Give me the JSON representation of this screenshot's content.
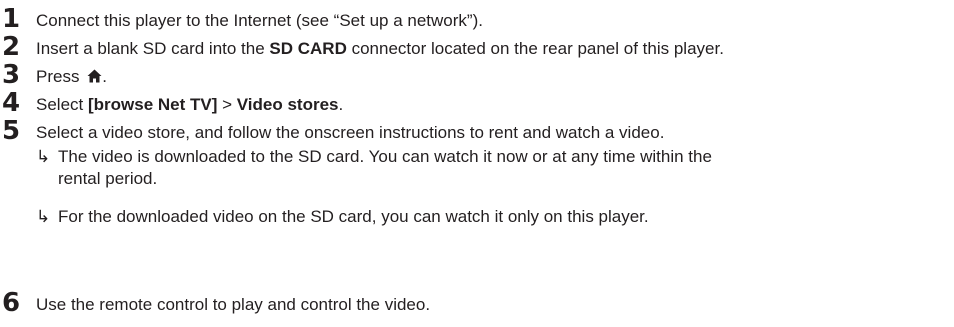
{
  "steps": [
    {
      "number": "1",
      "text": "Connect this player to the Internet (see “Set up a network”)."
    },
    {
      "number": "2",
      "before": "Insert a blank SD card into the ",
      "bold": "SD CARD",
      "after": " connector located on the rear panel of this player."
    },
    {
      "number": "3",
      "before": "Press ",
      "icon": "home-icon",
      "after": "."
    },
    {
      "number": "4",
      "before": "Select ",
      "bold1": "[browse Net TV]",
      "middle": " > ",
      "bold2": "Video stores",
      "after": "."
    },
    {
      "number": "5",
      "text": "Select a video store, and follow the onscreen instructions to rent and watch a video.",
      "results": [
        {
          "arrow": "↳",
          "line1": "The video is downloaded to the SD card. You can watch it now or at any time within the",
          "line2": "rental period."
        },
        {
          "arrow": "↳",
          "line1": "For the downloaded video on the SD card, you can watch it only on this player."
        }
      ]
    },
    {
      "number": "6",
      "text": "Use the remote control to play and control the video."
    }
  ]
}
